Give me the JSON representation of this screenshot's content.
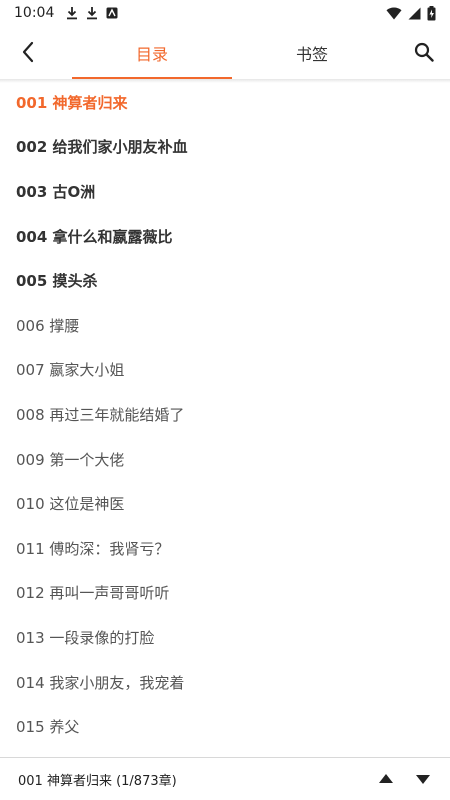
{
  "status_bar": {
    "time": "10:04",
    "left_icons": [
      "download-icon",
      "download-icon",
      "app-notification-icon"
    ],
    "right_icons": [
      "wifi-icon",
      "signal-icon",
      "battery-charging-icon"
    ]
  },
  "header": {
    "tabs": [
      {
        "label": "目录",
        "active": true
      },
      {
        "label": "书签",
        "active": false
      }
    ],
    "accent_color": "#f2682c"
  },
  "chapters": [
    {
      "label": "001 神算者归来",
      "state": "current"
    },
    {
      "label": "002 给我们家小朋友补血",
      "state": "cached"
    },
    {
      "label": "003 古O洲",
      "state": "cached"
    },
    {
      "label": "004 拿什么和嬴露薇比",
      "state": "cached"
    },
    {
      "label": "005 摸头杀",
      "state": "cached"
    },
    {
      "label": "006 撑腰",
      "state": "normal"
    },
    {
      "label": "007 嬴家大小姐",
      "state": "normal"
    },
    {
      "label": "008 再过三年就能结婚了",
      "state": "normal"
    },
    {
      "label": "009 第一个大佬",
      "state": "normal"
    },
    {
      "label": "010 这位是神医",
      "state": "normal"
    },
    {
      "label": "011 傅昀深：我肾亏？",
      "state": "normal"
    },
    {
      "label": "012 再叫一声哥哥听听",
      "state": "normal"
    },
    {
      "label": "013 一段录像的打脸",
      "state": "normal"
    },
    {
      "label": "014 我家小朋友，我宠着",
      "state": "normal"
    },
    {
      "label": "015 养父",
      "state": "normal"
    }
  ],
  "bottom_bar": {
    "status": "001 神算者归来 (1/873章)"
  }
}
